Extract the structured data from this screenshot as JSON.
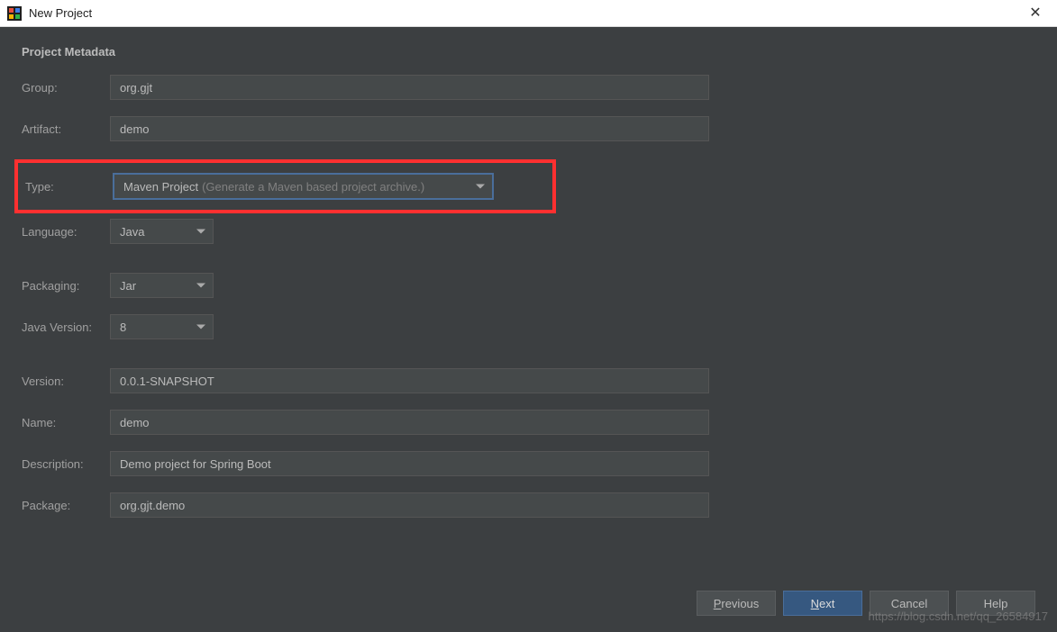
{
  "window": {
    "title": "New Project"
  },
  "section": {
    "title": "Project Metadata"
  },
  "fields": {
    "group": {
      "label": "Group:",
      "value": "org.gjt"
    },
    "artifact": {
      "label": "Artifact:",
      "value": "demo"
    },
    "type": {
      "label": "Type:",
      "value": "Maven Project",
      "hint": "(Generate a Maven based project archive.)"
    },
    "language": {
      "label": "Language:",
      "value": "Java"
    },
    "packaging": {
      "label": "Packaging:",
      "value": "Jar"
    },
    "javaVersion": {
      "label": "Java Version:",
      "value": "8"
    },
    "version": {
      "label": "Version:",
      "value": "0.0.1-SNAPSHOT"
    },
    "name": {
      "label": "Name:",
      "value": "demo"
    },
    "description": {
      "label": "Description:",
      "value": "Demo project for Spring Boot"
    },
    "package": {
      "label": "Package:",
      "value": "org.gjt.demo"
    }
  },
  "buttons": {
    "previous": "Previous",
    "next": "Next",
    "cancel": "Cancel",
    "help": "Help"
  },
  "watermark": "https://blog.csdn.net/qq_26584917"
}
